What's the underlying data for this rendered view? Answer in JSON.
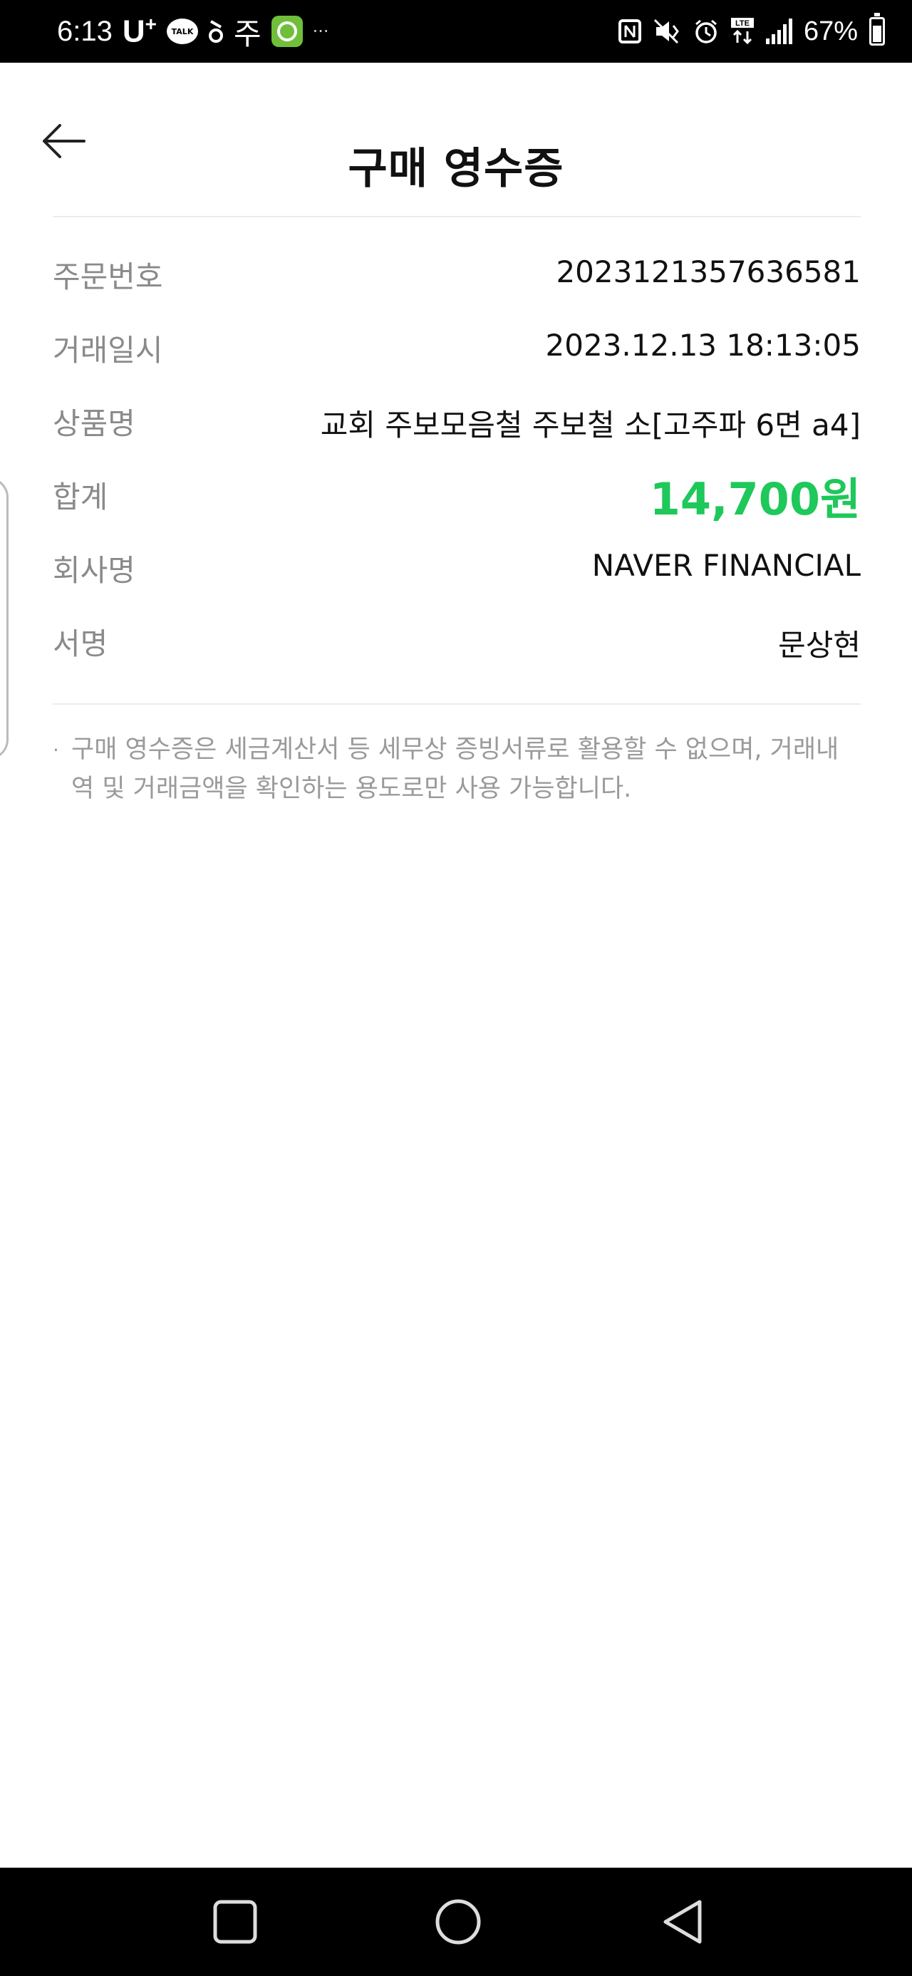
{
  "status_bar": {
    "time": "6:13",
    "carrier": "U",
    "carrier_sup": "+",
    "talk": "TALK",
    "ju": "주",
    "dots": "···",
    "battery_percent": "67%",
    "battery_level": 0.67,
    "icons": [
      "talk-icon",
      "notification-icon",
      "green-app-icon",
      "nfc-icon",
      "mute-icon",
      "alarm-icon",
      "lte-icon",
      "signal-icon",
      "battery-icon"
    ]
  },
  "header": {
    "title": "구매 영수증",
    "back_icon": "back-arrow-icon"
  },
  "receipt": {
    "rows": [
      {
        "label": "주문번호",
        "value": "2023121357636581"
      },
      {
        "label": "거래일시",
        "value": "2023.12.13 18:13:05"
      },
      {
        "label": "상품명",
        "value": "교회 주보모음철 주보철 소[고주파 6면 a4]"
      },
      {
        "label": "합계",
        "value": "14,700원"
      },
      {
        "label": "회사명",
        "value": "NAVER FINANCIAL"
      },
      {
        "label": "서명",
        "value": "문상현"
      }
    ]
  },
  "notice": {
    "bullet": "·",
    "text": "구매 영수증은 세금계산서 등 세무상 증빙서류로 활용할 수 없으며, 거래내역 및 거래금액을 확인하는 용도로만 사용 가능합니다."
  },
  "colors": {
    "accent_total": "#1ec85a",
    "label_gray": "#8a8a8a"
  },
  "nav": {
    "icons": [
      "recent-apps-icon",
      "home-icon",
      "back-icon"
    ]
  }
}
